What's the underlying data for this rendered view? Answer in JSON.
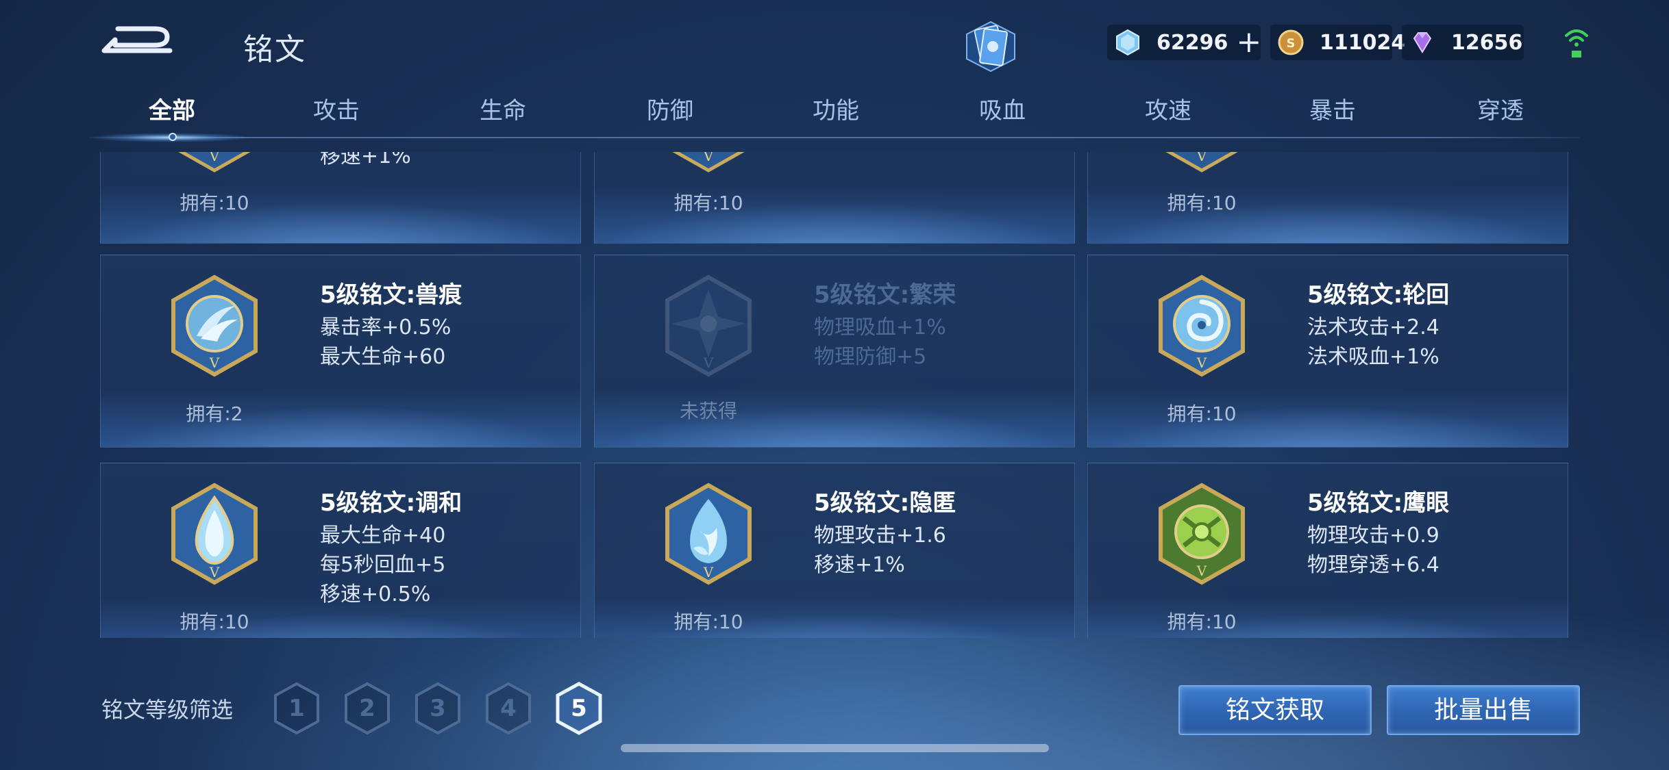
{
  "header": {
    "title": "铭文",
    "currencies": [
      {
        "name": "ticket",
        "value": "62296"
      },
      {
        "name": "gold",
        "value": "111024"
      },
      {
        "name": "gem",
        "value": "12656"
      }
    ]
  },
  "tabs": [
    {
      "label": "全部",
      "active": true
    },
    {
      "label": "攻击"
    },
    {
      "label": "生命"
    },
    {
      "label": "防御"
    },
    {
      "label": "功能"
    },
    {
      "label": "吸血"
    },
    {
      "label": "攻速"
    },
    {
      "label": "暴击"
    },
    {
      "label": "穿透"
    }
  ],
  "grid": {
    "top_row": [
      {
        "attr_partial": "移速+1%",
        "owned": "拥有:10"
      },
      {
        "owned": "拥有:10"
      },
      {
        "owned": "拥有:10"
      }
    ],
    "items": [
      {
        "name": "5级铭文:兽痕",
        "attrs": [
          "暴击率+0.5%",
          "最大生命+60"
        ],
        "owned": "拥有:2",
        "icon": "beast-claw-icon",
        "color": "#3b6fa8"
      },
      {
        "name": "5级铭文:繁荣",
        "attrs": [
          "物理吸血+1%",
          "物理防御+5"
        ],
        "owned": "未获得",
        "icon": "prosperity-icon",
        "color": "#3b6fa8",
        "locked": true
      },
      {
        "name": "5级铭文:轮回",
        "attrs": [
          "法术攻击+2.4",
          "法术吸血+1%"
        ],
        "owned": "拥有:10",
        "icon": "vortex-icon",
        "color": "#3b6fa8"
      },
      {
        "name": "5级铭文:调和",
        "attrs": [
          "最大生命+40",
          "每5秒回血+5",
          "移速+0.5%"
        ],
        "owned": "拥有:10",
        "icon": "droplet-icon",
        "color": "#3b6fa8"
      },
      {
        "name": "5级铭文:隐匿",
        "attrs": [
          "物理攻击+1.6",
          "移速+1%"
        ],
        "owned": "拥有:10",
        "icon": "flame-icon",
        "color": "#3b6fa8"
      },
      {
        "name": "5级铭文:鹰眼",
        "attrs": [
          "物理攻击+0.9",
          "物理穿透+6.4"
        ],
        "owned": "拥有:10",
        "icon": "hawk-eye-icon",
        "color": "#5f8a3a"
      }
    ]
  },
  "footer": {
    "filter_label": "铭文等级筛选",
    "levels": [
      "1",
      "2",
      "3",
      "4",
      "5"
    ],
    "active_level": "5",
    "get_button": "铭文获取",
    "sell_button": "批量出售"
  }
}
